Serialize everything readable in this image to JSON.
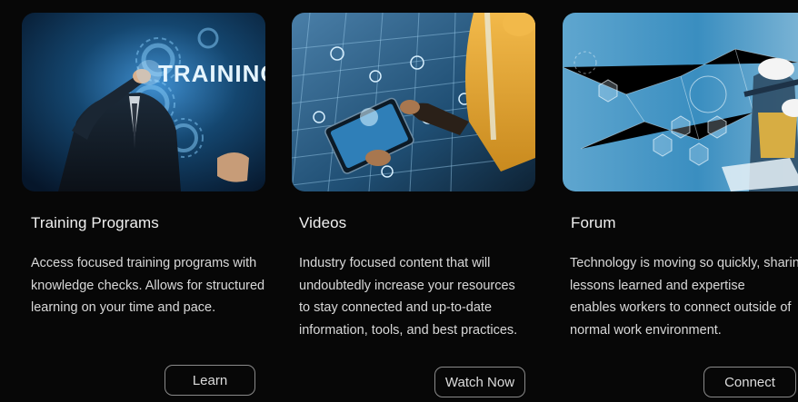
{
  "cards": [
    {
      "image": {
        "alt": "Businessman touching gear graphic labeled training",
        "overlay_text": "TRAINING"
      },
      "title": "Training Programs",
      "description": "Access focused training programs with knowledge checks. Allows for structured learning on your time and pace.",
      "button_label": "Learn"
    },
    {
      "image": {
        "alt": "Worker holding tablet over solar panels with floating icons"
      },
      "title": "Videos",
      "description": "Industry focused content that will undoubtedly increase your resources to stay connected and up-to-date information, tools, and best practices.",
      "button_label": "Watch Now"
    },
    {
      "image": {
        "alt": "Engineers in hard hats with technology network overlay"
      },
      "title": "Forum",
      "description": "Technology is moving so quickly, sharing lessons learned and expertise\n enables workers to connect outside of normal work environment.",
      "button_label": "Connect"
    }
  ],
  "colors": {
    "background": "#070707",
    "text": "#e8e8e8",
    "button_border": "#8a8a8a"
  }
}
